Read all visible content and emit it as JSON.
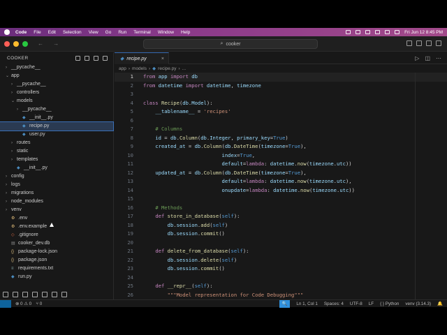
{
  "menubar": {
    "app": "Code",
    "items": [
      "File",
      "Edit",
      "Selection",
      "View",
      "Go",
      "Run",
      "Terminal",
      "Window",
      "Help"
    ],
    "datetime": "Fri Jun 12  8:45 PM"
  },
  "window": {
    "search_text": "cooker",
    "nav_arrows": "← →"
  },
  "explorer": {
    "title": "COOKER",
    "tree": [
      {
        "label": "__pycache__",
        "depth": 0,
        "type": "folder",
        "open": false
      },
      {
        "label": "app",
        "depth": 0,
        "type": "folder",
        "open": true
      },
      {
        "label": "__pycache__",
        "depth": 1,
        "type": "folder",
        "open": false
      },
      {
        "label": "controllers",
        "depth": 1,
        "type": "folder",
        "open": false
      },
      {
        "label": "models",
        "depth": 1,
        "type": "folder",
        "open": true
      },
      {
        "label": "__pycache__",
        "depth": 2,
        "type": "folder",
        "open": false
      },
      {
        "label": "__init__.py",
        "depth": 2,
        "type": "py"
      },
      {
        "label": "recipe.py",
        "depth": 2,
        "type": "py",
        "selected": true
      },
      {
        "label": "user.py",
        "depth": 2,
        "type": "py"
      },
      {
        "label": "routes",
        "depth": 1,
        "type": "folder",
        "open": false
      },
      {
        "label": "static",
        "depth": 1,
        "type": "folder",
        "open": false
      },
      {
        "label": "templates",
        "depth": 1,
        "type": "folder",
        "open": false
      },
      {
        "label": "__init__.py",
        "depth": 1,
        "type": "py"
      },
      {
        "label": "config",
        "depth": 0,
        "type": "folder",
        "open": false
      },
      {
        "label": "logs",
        "depth": 0,
        "type": "folder",
        "open": false
      },
      {
        "label": "migrations",
        "depth": 0,
        "type": "folder",
        "open": false
      },
      {
        "label": "node_modules",
        "depth": 0,
        "type": "folder",
        "open": false
      },
      {
        "label": "venv",
        "depth": 0,
        "type": "folder",
        "open": false
      },
      {
        "label": ".env",
        "depth": 0,
        "type": "env"
      },
      {
        "label": ".env.example",
        "depth": 0,
        "type": "env"
      },
      {
        "label": ".gitignore",
        "depth": 0,
        "type": "git"
      },
      {
        "label": "cooker_dev.db",
        "depth": 0,
        "type": "db"
      },
      {
        "label": "package-lock.json",
        "depth": 0,
        "type": "json"
      },
      {
        "label": "package.json",
        "depth": 0,
        "type": "json"
      },
      {
        "label": "requirements.txt",
        "depth": 0,
        "type": "txt"
      },
      {
        "label": "run.py",
        "depth": 0,
        "type": "py"
      }
    ]
  },
  "editor": {
    "tab_label": "recipe.py",
    "breadcrumb": [
      "app",
      "models",
      "recipe.py",
      "..."
    ],
    "current_line": 1
  },
  "code_lines": [
    "from app import db",
    "from datetime import datetime, timezone",
    "",
    "class Recipe(db.Model):",
    "    __tablename__ = 'recipes'",
    "",
    "    # Columns",
    "    id = db.Column(db.Integer, primary_key=True)",
    "    created_at = db.Column(db.DateTime(timezone=True),",
    "                          index=True,",
    "                          default=lambda: datetime.now(timezone.utc))",
    "    updated_at = db.Column(db.DateTime(timezone=True),",
    "                          default=lambda: datetime.now(timezone.utc),",
    "                          onupdate=lambda: datetime.now(timezone.utc))",
    "",
    "    # Methods",
    "    def store_in_database(self):",
    "        db.session.add(self)",
    "        db.session.commit()",
    "",
    "    def delete_from_database(self):",
    "        db.session.delete(self)",
    "        db.session.commit()",
    "",
    "    def __repr__(self):",
    "        \"\"\"Model representation for Code Debugging\"\"\""
  ],
  "statusbar": {
    "problems": "⊗ 0 ⚠ 0",
    "ports": "⑂ 0",
    "zoom": "🔍",
    "position": "Ln 1, Col 1",
    "spaces": "Spaces: 4",
    "encoding": "UTF-8",
    "eol": "LF",
    "language": "{ } Python",
    "interpreter": "venv (3.14.3)"
  }
}
